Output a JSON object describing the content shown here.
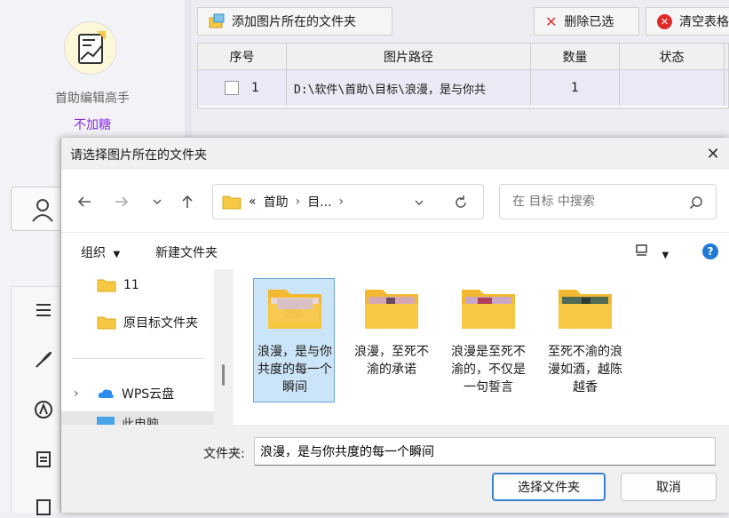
{
  "app": {
    "name": "首助编辑高手",
    "subtitle": "不加糖",
    "toolbar": {
      "add_folder_label": "添加图片所在的文件夹",
      "delete_selected_label": "删除已选",
      "clear_table_label": "清空表格"
    },
    "table": {
      "headers": [
        "序号",
        "图片路径",
        "数量",
        "状态"
      ],
      "rows": [
        {
          "index": "1",
          "path": "D:\\软件\\首助\\目标\\浪漫，是与你共",
          "count": "1",
          "status": ""
        }
      ]
    }
  },
  "dialog": {
    "title": "请选择图片所在的文件夹",
    "address": {
      "prefix": "«",
      "crumbs": [
        "首助",
        "目..."
      ]
    },
    "search_placeholder": "在 目标 中搜索",
    "commands": {
      "organize": "组织",
      "new_folder": "新建文件夹"
    },
    "nav_items": [
      {
        "label": "11"
      },
      {
        "label": "原目标文件夹"
      },
      {
        "label": "WPS云盘"
      },
      {
        "label": "此电脑"
      }
    ],
    "files": [
      {
        "name": "浪漫，是与你共度的每一个瞬间",
        "selected": true
      },
      {
        "name": "浪漫，至死不渝的承诺",
        "selected": false
      },
      {
        "name": "浪漫是至死不渝的，不仅是一句誓言",
        "selected": false
      },
      {
        "name": "至死不渝的浪漫如酒，越陈越香",
        "selected": false
      }
    ],
    "folder_label": "文件夹:",
    "folder_value": "浪漫，是与你共度的每一个瞬间",
    "select_button": "选择文件夹",
    "cancel_button": "取消"
  },
  "colors": {
    "accent": "#3b7fcf",
    "folder": "#f7c843",
    "subtitle": "#8a2be2"
  }
}
